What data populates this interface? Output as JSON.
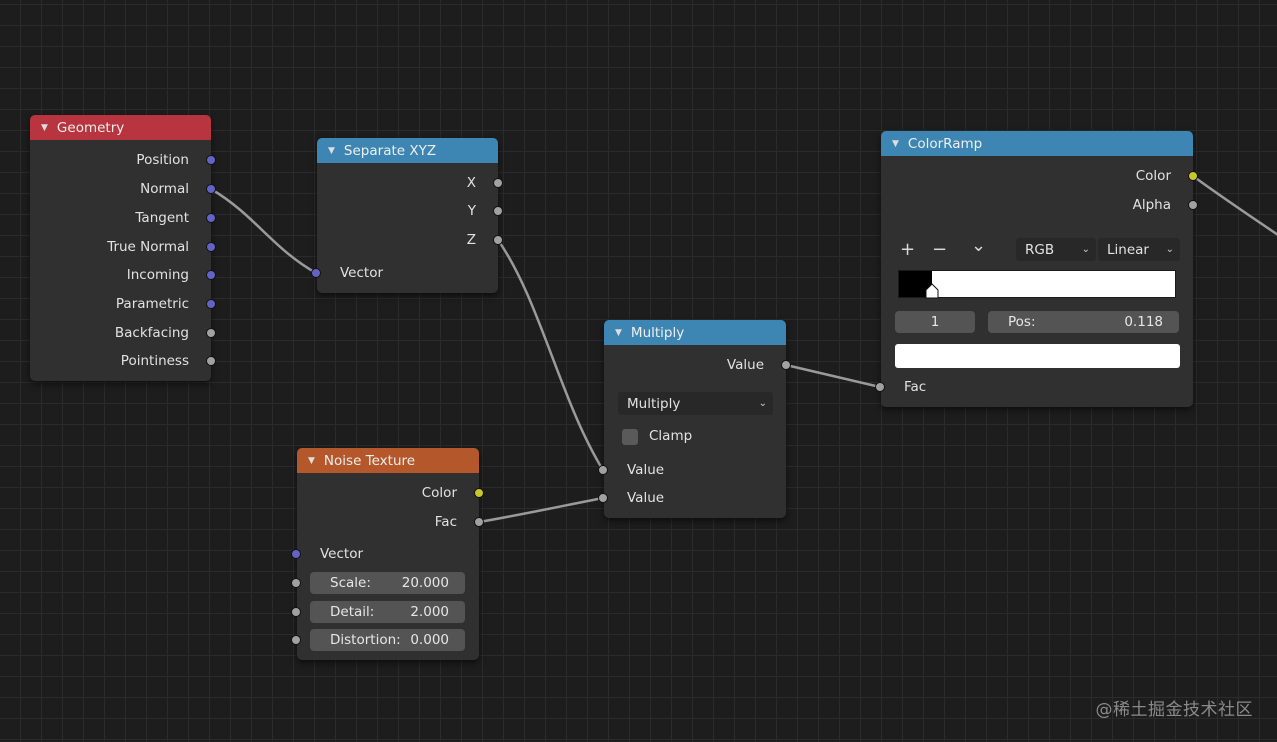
{
  "nodes": {
    "geometry": {
      "title": "Geometry",
      "outputs": [
        "Position",
        "Normal",
        "Tangent",
        "True Normal",
        "Incoming",
        "Parametric",
        "Backfacing",
        "Pointiness"
      ]
    },
    "separate_xyz": {
      "title": "Separate XYZ",
      "outputs": [
        "X",
        "Y",
        "Z"
      ],
      "inputs": [
        "Vector"
      ]
    },
    "multiply": {
      "title": "Multiply",
      "outputs": [
        "Value"
      ],
      "operation": "Multiply",
      "clamp_label": "Clamp",
      "clamp_checked": false,
      "inputs": [
        "Value",
        "Value"
      ]
    },
    "noise_texture": {
      "title": "Noise Texture",
      "outputs": [
        "Color",
        "Fac"
      ],
      "vector_label": "Vector",
      "fields": [
        {
          "label": "Scale:",
          "value": "20.000"
        },
        {
          "label": "Detail:",
          "value": "2.000"
        },
        {
          "label": "Distortion:",
          "value": "0.000"
        }
      ]
    },
    "colorramp": {
      "title": "ColorRamp",
      "outputs": [
        "Color",
        "Alpha"
      ],
      "toolbar": {
        "add_symbol": "+",
        "remove_symbol": "−",
        "menu_symbol": "⌄",
        "color_mode": "RGB",
        "interpolation": "Linear"
      },
      "stop_position": 0.118,
      "active_stop_index": "1",
      "pos_label": "Pos:",
      "pos_value": "0.118",
      "stop_color": "#ffffff",
      "input_label": "Fac"
    }
  },
  "colors": {
    "header_input": "#b8343f",
    "header_converter": "#3d85b2",
    "header_texture": "#b4582c",
    "socket_vector": "#6363c7",
    "socket_value": "#a1a1a1",
    "socket_color": "#c7c729",
    "link": "#9a9a9a"
  },
  "watermark": "@稀土掘金技术社区"
}
